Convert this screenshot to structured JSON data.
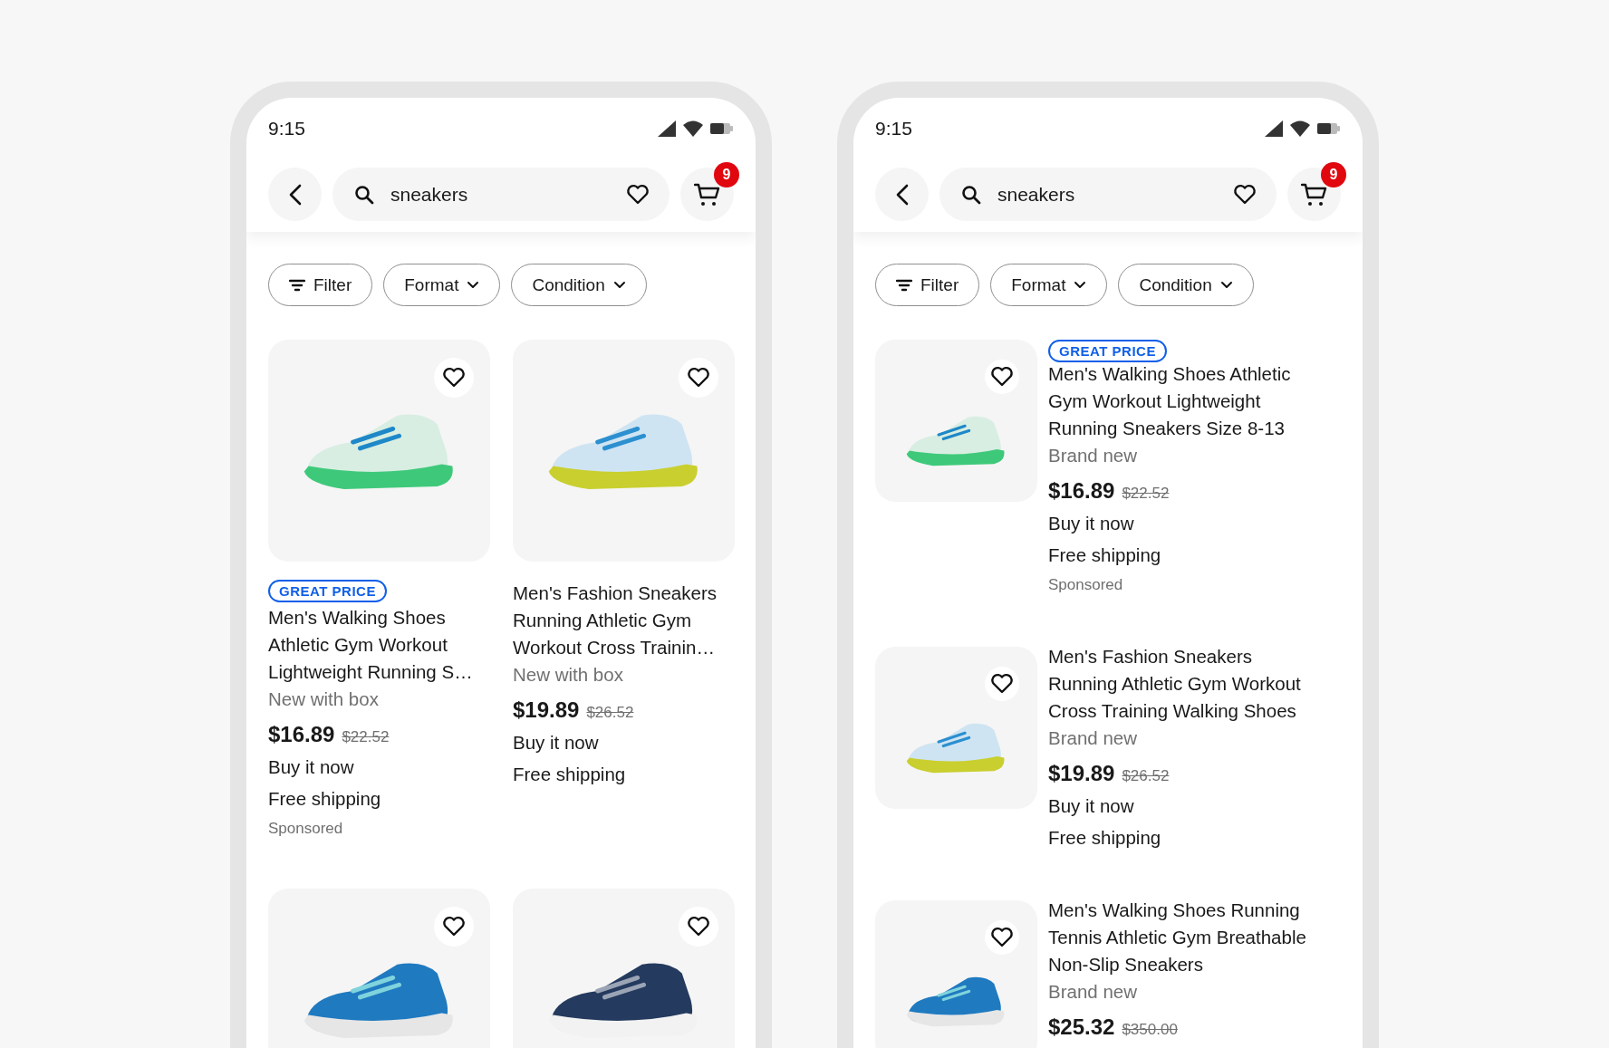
{
  "phones": [
    {
      "kind": "grid",
      "status_bar": {
        "time": "9:15"
      },
      "search": {
        "value": "sneakers"
      },
      "cart_badge": "9",
      "filters": [
        {
          "kind": "filter",
          "label": "Filter"
        },
        {
          "kind": "dropdown",
          "label": "Format"
        },
        {
          "kind": "dropdown",
          "label": "Condition"
        }
      ],
      "products": [
        {
          "kind": "full",
          "badge": "GREAT PRICE",
          "title": "Men's Walking Shoes Athletic Gym Workout Lightweight Running S…",
          "condition": "New with box",
          "price": "$16.89",
          "original_price": "$22.52",
          "buying_format": "Buy it now",
          "shipping": "Free shipping",
          "sponsored": "Sponsored"
        },
        {
          "kind": "full",
          "title": "Men's Fashion Sneakers Running Athletic Gym Workout Cross Trainin…",
          "condition": "New with box",
          "price": "$19.89",
          "original_price": "$26.52",
          "buying_format": "Buy it now",
          "shipping": "Free shipping"
        },
        {
          "kind": "photo_only"
        },
        {
          "kind": "photo_only"
        }
      ]
    },
    {
      "kind": "list",
      "status_bar": {
        "time": "9:15"
      },
      "search": {
        "value": "sneakers"
      },
      "cart_badge": "9",
      "filters": [
        {
          "kind": "filter",
          "label": "Filter"
        },
        {
          "kind": "dropdown",
          "label": "Format"
        },
        {
          "kind": "dropdown",
          "label": "Condition"
        }
      ],
      "products": [
        {
          "kind": "full",
          "badge": "GREAT PRICE",
          "title": "Men's Walking Shoes Athletic Gym Workout Lightweight Running Sneakers Size 8-13",
          "condition": "Brand new",
          "price": "$16.89",
          "original_price": "$22.52",
          "buying_format": "Buy it now",
          "shipping": "Free shipping",
          "sponsored": "Sponsored"
        },
        {
          "kind": "full",
          "title": "Men's Fashion Sneakers Running Athletic Gym Workout Cross Training Walking Shoes",
          "condition": "Brand new",
          "price": "$19.89",
          "original_price": "$26.52",
          "buying_format": "Buy it now",
          "shipping": "Free shipping"
        },
        {
          "kind": "full",
          "title": "Men's Walking Shoes Running Tennis Athletic Gym Breathable Non-Slip Sneakers",
          "condition": "Brand new",
          "price": "$25.32",
          "original_price": "$350.00"
        }
      ]
    }
  ]
}
